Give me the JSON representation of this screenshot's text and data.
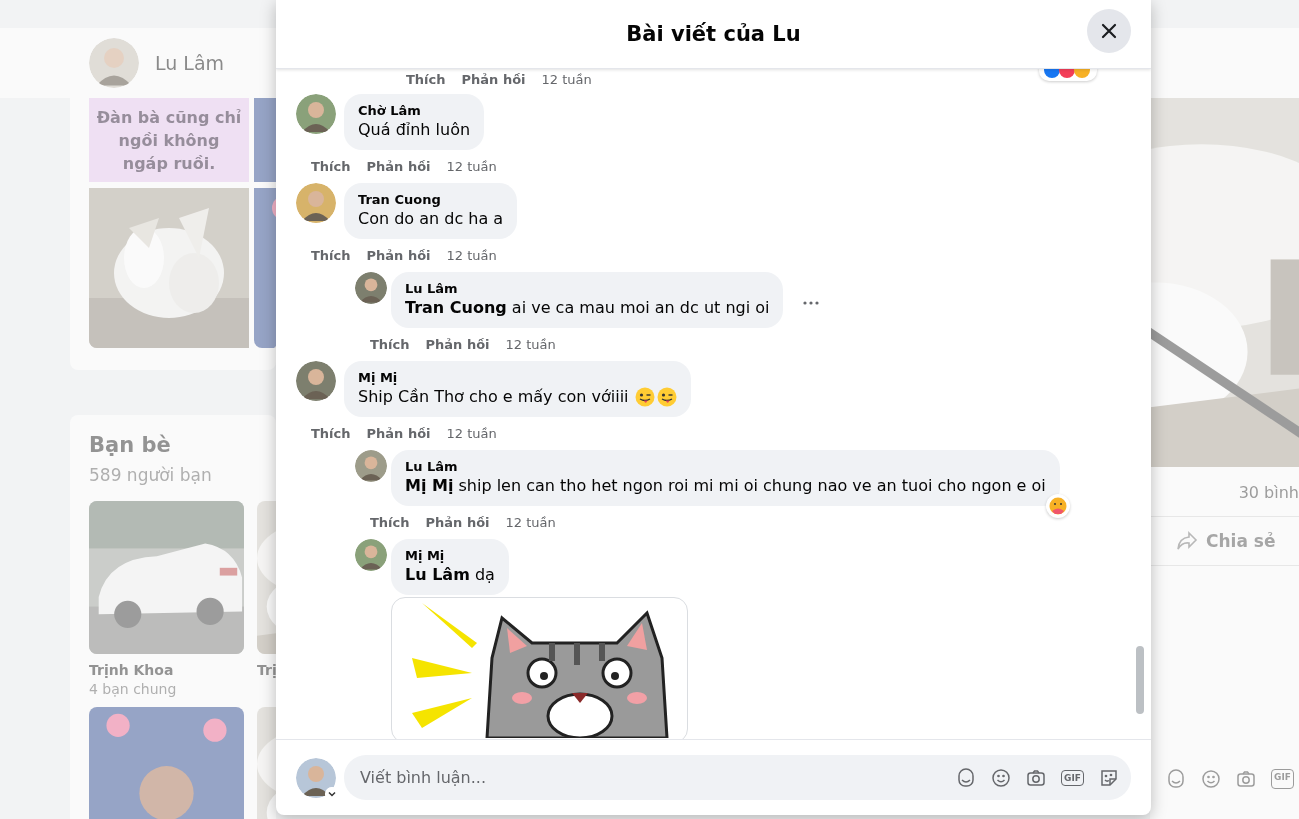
{
  "background": {
    "profile": {
      "name": "Lu Lâm"
    },
    "photos_card": {
      "quote": "Đàn bà cũng chỉ ngồi không ngáp ruồi."
    },
    "friends": {
      "title": "Bạn bè",
      "count": "589 người bạn",
      "items": [
        {
          "name": "Trịnh Khoa",
          "mutual": "4 bạn chung"
        },
        {
          "name": "Trị"
        }
      ]
    },
    "post": {
      "comment_count": "30 bình",
      "share": "Chia sẻ",
      "gif_label": "GIF"
    }
  },
  "modal": {
    "title": "Bài viết của Lu",
    "top_actions": {
      "like": "Thích",
      "reply": "Phản hồi",
      "time": "12 tuần"
    },
    "comments": [
      {
        "author": "Chờ Lâm",
        "text": "Quá đỉnh luôn",
        "actions": {
          "like": "Thích",
          "reply": "Phản hồi",
          "time": "12 tuần"
        }
      },
      {
        "author": "Tran Cuong",
        "text": "Con do an dc ha a",
        "actions": {
          "like": "Thích",
          "reply": "Phản hồi",
          "time": "12 tuần"
        },
        "children": [
          {
            "author": "Lu Lâm",
            "text": "**Tran Cuong** ai ve ca mau moi an dc ut ngi oi",
            "show_more": true,
            "actions": {
              "like": "Thích",
              "reply": "Phản hồi",
              "time": "12 tuần"
            }
          }
        ]
      },
      {
        "author": "Mị Mị",
        "text": "Ship Cần Thơ cho e mấy con vớiiii",
        "has_emoji": true,
        "actions": {
          "like": "Thích",
          "reply": "Phản hồi",
          "time": "12 tuần"
        },
        "children": [
          {
            "author": "Lu Lâm",
            "text": "**Mị Mị** ship len can tho het ngon roi mi mi oi chung nao ve an tuoi cho ngon e oi",
            "reacted": true,
            "actions": {
              "like": "Thích",
              "reply": "Phản hồi",
              "time": "12 tuần"
            }
          },
          {
            "author": "Mị Mị",
            "text": "**Lu Lâm** dạ",
            "sticker": true
          }
        ]
      }
    ],
    "composer": {
      "placeholder": "Viết bình luận...",
      "gif_label": "GIF"
    }
  }
}
